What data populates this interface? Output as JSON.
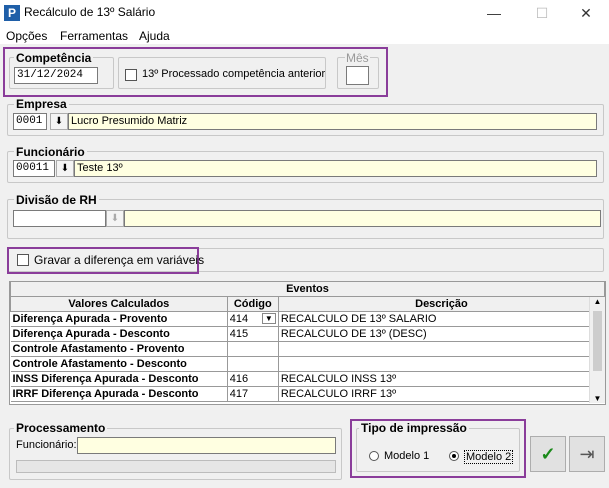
{
  "window": {
    "title": "Recálculo de 13º Salário",
    "min": "—",
    "max": "☐",
    "close": "✕",
    "icon": "P"
  },
  "menu": [
    "Opções",
    "Ferramentas",
    "Ajuda"
  ],
  "competencia": {
    "label": "Competência",
    "value": "31/12/2024",
    "checkbox_label": "13º Processado competência anterior",
    "checked": false
  },
  "mes": {
    "label": "Mês",
    "value": ""
  },
  "empresa": {
    "label": "Empresa",
    "code": "0001",
    "name": "Lucro Presumido Matriz"
  },
  "funcionario": {
    "label": "Funcionário",
    "code": "00011",
    "name": "Teste 13º"
  },
  "divisao": {
    "label": "Divisão de RH",
    "code": "",
    "name": ""
  },
  "gravar": {
    "label": "Gravar a diferença em variáveis",
    "checked": false
  },
  "eventos": {
    "title": "Eventos",
    "headers": [
      "Valores Calculados",
      "Código",
      "Descrição"
    ],
    "rows": [
      {
        "valor": "Diferença Apurada - Provento",
        "codigo": "414",
        "descricao": "RECALCULO DE 13º SALARIO"
      },
      {
        "valor": "Diferença Apurada - Desconto",
        "codigo": "415",
        "descricao": "RECALCULO DE 13º (DESC)"
      },
      {
        "valor": "Controle Afastamento - Provento",
        "codigo": "",
        "descricao": ""
      },
      {
        "valor": "Controle Afastamento - Desconto",
        "codigo": "",
        "descricao": ""
      },
      {
        "valor": "INSS Diferença Apurada - Desconto",
        "codigo": "416",
        "descricao": "RECALCULO  INSS 13º"
      },
      {
        "valor": "IRRF Diferença Apurada - Desconto",
        "codigo": "417",
        "descricao": "RECALCULO IRRF 13º"
      }
    ]
  },
  "processamento": {
    "label": "Processamento",
    "funcionario_label": "Funcionário:",
    "funcionario_value": "",
    "progress": 0
  },
  "tipo_impressao": {
    "label": "Tipo de impressão",
    "options": [
      "Modelo 1",
      "Modelo 2"
    ],
    "selected": "Modelo 2"
  },
  "buttons": {
    "ok_icon": "✓",
    "exit_icon": "⇥"
  },
  "colors": {
    "highlight": "#8a3d9a",
    "field_yellow": "#ffffe1"
  }
}
